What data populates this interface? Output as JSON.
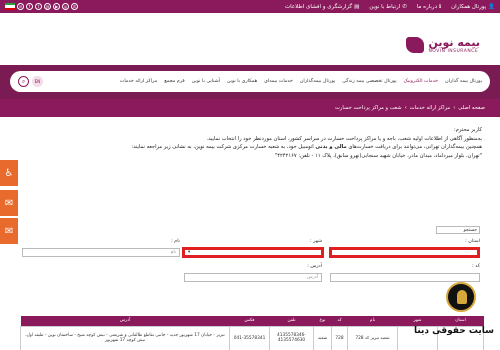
{
  "topbar": {
    "links": [
      "پورتال همکاران",
      "درباره ما",
      "ارتباط با نوین",
      "گزارشگری و افشای اطلاعات"
    ],
    "socials": [
      "in",
      "f",
      "t",
      "@",
      "▶",
      "◎",
      "✆"
    ]
  },
  "brand": {
    "name_fa": "بیمه نوین",
    "name_en": "NOVIN INSURANCE"
  },
  "nav": {
    "items": [
      "پورتال بیمه گذاران",
      "خدمات الکترونیک",
      "پورتال تخصصی بیمه زندگی",
      "پورتال بیمه‌گذاران",
      "خدمات بیمه‌ای",
      "همکاری با نوین",
      "آشنایی با نوین",
      "فرم مجمع",
      "مراکز ارائه خدمات"
    ],
    "lang": "EN"
  },
  "breadcrumb": [
    "صفحه اصلی",
    "مراکز ارائه خدمات",
    "شعب و مراکز پرداخت خسارت"
  ],
  "intro": {
    "line1": "کاربر محترم:",
    "line2": "به‌منظور آگاهی از اطلاعات اولیه شعب، باجه و یا مراکز پرداخت خسارت در سراسر کشور، استان موردنظر خود را انتخاب نمایید.",
    "line3a": "همچنین بیمه‌گذاران تهرانی، می‌توانند برای دریافت خسارت‌های",
    "line3b": "مالی و بدنی",
    "line3c": "اتومبیل خود، به شعبه خسارت مرکزی شرکت بیمه نوین، به نشانی زیر مراجعه نمایند:",
    "line4": "\"تهران، بلوار میرداماد، میدان مادر، خیابان شهید سنجابی(نهرو سابق)، پلاک ۱۱ - تلفن: ۴۲۴۲۱۶۷\""
  },
  "form": {
    "search_type": "جستجو",
    "province_label": "استان :",
    "city_label": "شهر :",
    "name_label": "نام :",
    "name_placeholder": "نام",
    "code_label": "کد :",
    "address_label": "آدرس :",
    "address_placeholder": "آدرس"
  },
  "table": {
    "headers": [
      "استان",
      "شهر",
      "نام",
      "کد",
      "نوع",
      "تلفن",
      "فکس",
      "آدرس"
    ],
    "rows": [
      [
        "",
        "",
        "شعبه تبریز کد 728",
        "728",
        "شعبه",
        "4135578346-4135574630",
        "041-35578341",
        "تبریز - خیابان 17 شهریور جدید - جانبی تقاطع طالقانی و شریعتی - نبش کوچه شیخ - ساختمان نوین - طبقه اول، نبش کوچه 17 شهریور"
      ]
    ]
  },
  "watermark": {
    "text": "سایت حقوقی دینا"
  }
}
